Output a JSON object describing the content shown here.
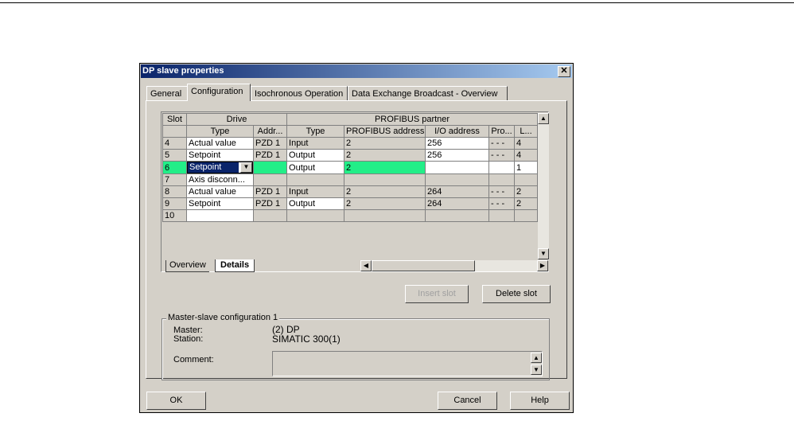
{
  "dialog": {
    "title": "DP slave properties",
    "close_glyph": "✕"
  },
  "tabs": [
    {
      "label": "General"
    },
    {
      "label": "Configuration"
    },
    {
      "label": "Isochronous Operation"
    },
    {
      "label": "Data Exchange Broadcast - Overview"
    }
  ],
  "grid": {
    "header_top": {
      "slot": "Slot",
      "drive": "Drive",
      "partner": "PROFIBUS partner"
    },
    "header_sub": {
      "type": "Type",
      "addr": "Addr...",
      "ptype": "Type",
      "paddr": "PROFIBUS address",
      "io": "I/O address",
      "pro": "Pro...",
      "l": "L..."
    },
    "rows": [
      {
        "slot": "4",
        "type": "Actual value",
        "addr": "PZD 1",
        "ptype": "Input",
        "paddr": "2",
        "io": "256",
        "pro": "- - -",
        "l": "4"
      },
      {
        "slot": "5",
        "type": "Setpoint",
        "addr": "PZD 1",
        "ptype": "Output",
        "paddr": "2",
        "io": "256",
        "pro": "- - -",
        "l": "4"
      },
      {
        "slot": "6",
        "type": "Setpoint",
        "addr": "",
        "ptype": "Output",
        "paddr": "2",
        "io": "",
        "pro": "",
        "l": "1"
      },
      {
        "slot": "7",
        "type": "Axis disconn...",
        "addr": "",
        "ptype": "",
        "paddr": "",
        "io": "",
        "pro": "",
        "l": ""
      },
      {
        "slot": "8",
        "type": "Actual value",
        "addr": "PZD 1",
        "ptype": "Input",
        "paddr": "2",
        "io": "264",
        "pro": "- - -",
        "l": "2"
      },
      {
        "slot": "9",
        "type": "Setpoint",
        "addr": "PZD 1",
        "ptype": "Output",
        "paddr": "2",
        "io": "264",
        "pro": "- - -",
        "l": "2"
      },
      {
        "slot": "10",
        "type": "",
        "addr": "",
        "ptype": "",
        "paddr": "",
        "io": "",
        "pro": "",
        "l": ""
      }
    ],
    "sheet_tabs": {
      "overview": "Overview",
      "details": "Details"
    }
  },
  "buttons": {
    "insert_slot": "Insert slot",
    "delete_slot": "Delete slot",
    "ok": "OK",
    "cancel": "Cancel",
    "help": "Help"
  },
  "master_slave": {
    "group_label": "Master-slave configuration 1",
    "master_label": "Master:",
    "master_value": "(2) DP",
    "station_label": "Station:",
    "station_value": "SIMATIC 300(1)",
    "comment_label": "Comment:"
  },
  "colors": {
    "title_bar": "#0a246a",
    "highlight_green": "#22ee88",
    "dialog_face": "#d4d0c8"
  }
}
